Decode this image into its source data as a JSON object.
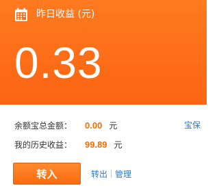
{
  "header": {
    "title": "昨日收益 (元)",
    "amount": "0.33",
    "icon": "calendar-icon"
  },
  "summary": {
    "total_label": "余额宝总金额：",
    "total_value": "0.00",
    "total_unit": "元",
    "history_label": "我的历史收益：",
    "history_value": "99.89",
    "history_unit": "元",
    "product_link": "宝保"
  },
  "actions": {
    "transfer_in": "转入",
    "transfer_out": "转出",
    "manage": "管理"
  },
  "colors": {
    "accent": "#fb6a16",
    "value": "#ff6a00",
    "link": "#2a78c8"
  }
}
